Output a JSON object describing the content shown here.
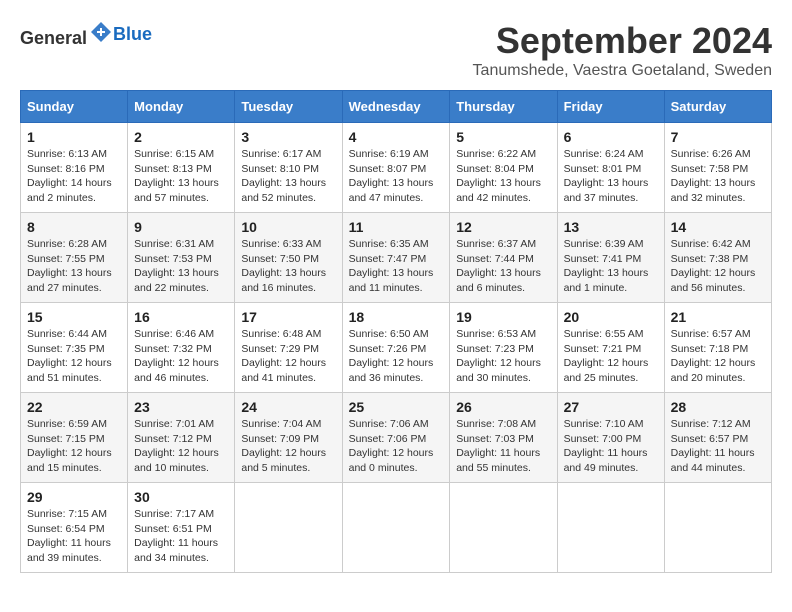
{
  "header": {
    "logo_general": "General",
    "logo_blue": "Blue",
    "month": "September 2024",
    "location": "Tanumshede, Vaestra Goetaland, Sweden"
  },
  "days_of_week": [
    "Sunday",
    "Monday",
    "Tuesday",
    "Wednesday",
    "Thursday",
    "Friday",
    "Saturday"
  ],
  "weeks": [
    [
      {
        "day": "1",
        "sunrise": "6:13 AM",
        "sunset": "8:16 PM",
        "daylight": "14 hours and 2 minutes."
      },
      {
        "day": "2",
        "sunrise": "6:15 AM",
        "sunset": "8:13 PM",
        "daylight": "13 hours and 57 minutes."
      },
      {
        "day": "3",
        "sunrise": "6:17 AM",
        "sunset": "8:10 PM",
        "daylight": "13 hours and 52 minutes."
      },
      {
        "day": "4",
        "sunrise": "6:19 AM",
        "sunset": "8:07 PM",
        "daylight": "13 hours and 47 minutes."
      },
      {
        "day": "5",
        "sunrise": "6:22 AM",
        "sunset": "8:04 PM",
        "daylight": "13 hours and 42 minutes."
      },
      {
        "day": "6",
        "sunrise": "6:24 AM",
        "sunset": "8:01 PM",
        "daylight": "13 hours and 37 minutes."
      },
      {
        "day": "7",
        "sunrise": "6:26 AM",
        "sunset": "7:58 PM",
        "daylight": "13 hours and 32 minutes."
      }
    ],
    [
      {
        "day": "8",
        "sunrise": "6:28 AM",
        "sunset": "7:55 PM",
        "daylight": "13 hours and 27 minutes."
      },
      {
        "day": "9",
        "sunrise": "6:31 AM",
        "sunset": "7:53 PM",
        "daylight": "13 hours and 22 minutes."
      },
      {
        "day": "10",
        "sunrise": "6:33 AM",
        "sunset": "7:50 PM",
        "daylight": "13 hours and 16 minutes."
      },
      {
        "day": "11",
        "sunrise": "6:35 AM",
        "sunset": "7:47 PM",
        "daylight": "13 hours and 11 minutes."
      },
      {
        "day": "12",
        "sunrise": "6:37 AM",
        "sunset": "7:44 PM",
        "daylight": "13 hours and 6 minutes."
      },
      {
        "day": "13",
        "sunrise": "6:39 AM",
        "sunset": "7:41 PM",
        "daylight": "13 hours and 1 minute."
      },
      {
        "day": "14",
        "sunrise": "6:42 AM",
        "sunset": "7:38 PM",
        "daylight": "12 hours and 56 minutes."
      }
    ],
    [
      {
        "day": "15",
        "sunrise": "6:44 AM",
        "sunset": "7:35 PM",
        "daylight": "12 hours and 51 minutes."
      },
      {
        "day": "16",
        "sunrise": "6:46 AM",
        "sunset": "7:32 PM",
        "daylight": "12 hours and 46 minutes."
      },
      {
        "day": "17",
        "sunrise": "6:48 AM",
        "sunset": "7:29 PM",
        "daylight": "12 hours and 41 minutes."
      },
      {
        "day": "18",
        "sunrise": "6:50 AM",
        "sunset": "7:26 PM",
        "daylight": "12 hours and 36 minutes."
      },
      {
        "day": "19",
        "sunrise": "6:53 AM",
        "sunset": "7:23 PM",
        "daylight": "12 hours and 30 minutes."
      },
      {
        "day": "20",
        "sunrise": "6:55 AM",
        "sunset": "7:21 PM",
        "daylight": "12 hours and 25 minutes."
      },
      {
        "day": "21",
        "sunrise": "6:57 AM",
        "sunset": "7:18 PM",
        "daylight": "12 hours and 20 minutes."
      }
    ],
    [
      {
        "day": "22",
        "sunrise": "6:59 AM",
        "sunset": "7:15 PM",
        "daylight": "12 hours and 15 minutes."
      },
      {
        "day": "23",
        "sunrise": "7:01 AM",
        "sunset": "7:12 PM",
        "daylight": "12 hours and 10 minutes."
      },
      {
        "day": "24",
        "sunrise": "7:04 AM",
        "sunset": "7:09 PM",
        "daylight": "12 hours and 5 minutes."
      },
      {
        "day": "25",
        "sunrise": "7:06 AM",
        "sunset": "7:06 PM",
        "daylight": "12 hours and 0 minutes."
      },
      {
        "day": "26",
        "sunrise": "7:08 AM",
        "sunset": "7:03 PM",
        "daylight": "11 hours and 55 minutes."
      },
      {
        "day": "27",
        "sunrise": "7:10 AM",
        "sunset": "7:00 PM",
        "daylight": "11 hours and 49 minutes."
      },
      {
        "day": "28",
        "sunrise": "7:12 AM",
        "sunset": "6:57 PM",
        "daylight": "11 hours and 44 minutes."
      }
    ],
    [
      {
        "day": "29",
        "sunrise": "7:15 AM",
        "sunset": "6:54 PM",
        "daylight": "11 hours and 39 minutes."
      },
      {
        "day": "30",
        "sunrise": "7:17 AM",
        "sunset": "6:51 PM",
        "daylight": "11 hours and 34 minutes."
      },
      null,
      null,
      null,
      null,
      null
    ]
  ]
}
